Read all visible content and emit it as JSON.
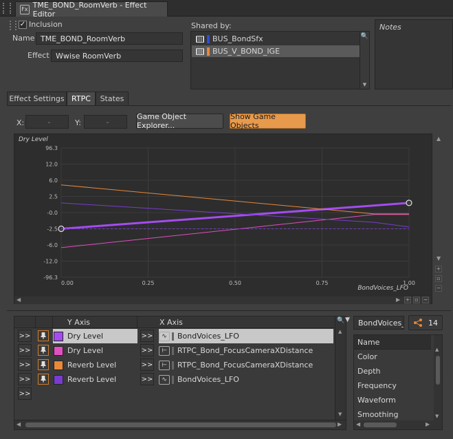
{
  "window": {
    "title": "TME_BOND_RoomVerb - Effect Editor"
  },
  "inclusion": {
    "label": "Inclusion",
    "checked": true
  },
  "name": {
    "label": "Name",
    "value": "TME_BOND_RoomVerb"
  },
  "effect": {
    "label": "Effect",
    "value": "Wwise RoomVerb"
  },
  "shared": {
    "label": "Shared by:",
    "items": [
      {
        "label": "BUS_BondSfx",
        "color": "#2f4fd6",
        "selected": false
      },
      {
        "label": "BUS_V_BOND_IGE",
        "color": "#e8883a",
        "selected": true
      }
    ]
  },
  "notes": {
    "label": "Notes"
  },
  "tabs": [
    {
      "label": "Effect Settings",
      "active": false
    },
    {
      "label": "RTPC",
      "active": true
    },
    {
      "label": "States",
      "active": false
    }
  ],
  "coords": {
    "x_label": "X:",
    "x_value": "-",
    "y_label": "Y:",
    "y_value": "-"
  },
  "buttons": {
    "explorer": "Game Object Explorer...",
    "show": "Show Game Objects"
  },
  "chart_data": {
    "type": "line",
    "ylabel": "Dry Level",
    "xlabel": "BondVoices_LFO",
    "y_ticks": [
      "96.3",
      "12.0",
      "6.0",
      "2.5",
      "-0.0",
      "-2.5",
      "-6.0",
      "-12.0",
      "-96.3"
    ],
    "x_ticks": [
      "0.00",
      "0.25",
      "0.50",
      "0.75",
      "1.00"
    ],
    "xlim": [
      0,
      1
    ],
    "series": [
      {
        "color": "#a44cf0",
        "points": [
          [
            0,
            -2.5
          ],
          [
            1,
            1.5
          ]
        ],
        "width": 3,
        "handles": true
      },
      {
        "color": "#e8883a",
        "points": [
          [
            0,
            5.0
          ],
          [
            0.9,
            -0.2
          ],
          [
            1,
            -0.2
          ]
        ],
        "width": 1
      },
      {
        "color": "#e24fc0",
        "points": [
          [
            0,
            -7.0
          ],
          [
            0.9,
            -0.3
          ],
          [
            1,
            -0.3
          ]
        ],
        "width": 1
      },
      {
        "color": "#7a3bd0",
        "points": [
          [
            0,
            1.5
          ],
          [
            0.9,
            -1.5
          ],
          [
            1,
            -2.2
          ]
        ],
        "width": 1
      },
      {
        "color": "#7a3bd0",
        "points": [
          [
            0,
            -2.5
          ],
          [
            1,
            -2.5
          ]
        ],
        "width": 1,
        "dashed": true
      }
    ]
  },
  "rtpc": {
    "y_header": "Y Axis",
    "x_header": "X Axis",
    "arrow": ">>",
    "rows": [
      {
        "y_label": "Dry Level",
        "color": "#a44cf0",
        "x_label": "BondVoices_LFO",
        "x_icon": "lfo-icon",
        "selected": true,
        "pinned": true
      },
      {
        "y_label": "Dry Level",
        "color": "#e24fc0",
        "x_label": "RTPC_Bond_FocusCameraXDistance",
        "x_icon": "rtpc-icon",
        "selected": false,
        "pinned": true
      },
      {
        "y_label": "Reverb Level",
        "color": "#e8883a",
        "x_label": "RTPC_Bond_FocusCameraXDistance",
        "x_icon": "rtpc-icon",
        "selected": false,
        "pinned": true
      },
      {
        "y_label": "Reverb Level",
        "color": "#7a3bd0",
        "x_label": "BondVoices_LFO",
        "x_icon": "lfo-icon",
        "selected": false,
        "pinned": true
      }
    ]
  },
  "props": {
    "search_value": "BondVoices_l",
    "count": "14",
    "header": "Name",
    "items": [
      "Color",
      "Depth",
      "Frequency",
      "Waveform",
      "Smoothing"
    ]
  }
}
